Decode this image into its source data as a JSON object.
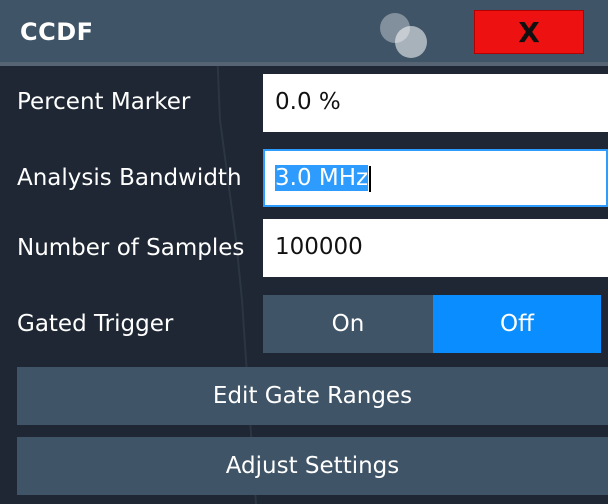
{
  "dialog": {
    "title": "CCDF",
    "close_label": "X"
  },
  "fields": {
    "percent_marker": {
      "label": "Percent Marker",
      "value": "0.0 %"
    },
    "analysis_bandwidth": {
      "label": "Analysis Bandwidth",
      "value": "3.0 MHz"
    },
    "number_of_samples": {
      "label": "Number of Samples",
      "value": "100000"
    }
  },
  "gated_trigger": {
    "label": "Gated Trigger",
    "on_label": "On",
    "off_label": "Off",
    "selected": "Off"
  },
  "buttons": {
    "edit_gate_ranges": "Edit Gate Ranges",
    "adjust_settings": "Adjust Settings"
  },
  "colors": {
    "title_bar": "#3f5467",
    "close_button": "#ee1111",
    "toggle_selected": "#0a8dff",
    "button": "#3f5467",
    "focus_border": "#2e9bff"
  }
}
